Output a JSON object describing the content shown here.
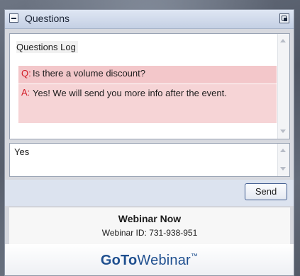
{
  "window": {
    "title": "Questions"
  },
  "log": {
    "heading": "Questions Log",
    "question_prefix": "Q:",
    "question": "Is there a volume discount?",
    "answer_prefix": "A:",
    "answer": "Yes! We will send you more info after the event."
  },
  "reply": {
    "value": "Yes"
  },
  "actions": {
    "send_label": "Send"
  },
  "footer": {
    "webinar_name": "Webinar Now",
    "webinar_id": "Webinar ID: 731-938-951"
  },
  "brand": {
    "part1": "GoTo",
    "part2": "Webinar",
    "tm": "™"
  },
  "colors": {
    "accent": "#1f4f8f",
    "highlight": "#f6d4d6",
    "prefix": "#d21b26"
  }
}
